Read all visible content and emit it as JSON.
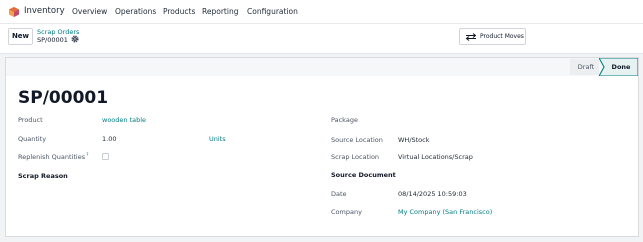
{
  "nav": {
    "app_name": "Inventory",
    "menu": [
      "Overview",
      "Operations",
      "Products",
      "Reporting",
      "Configuration"
    ]
  },
  "control_panel": {
    "new_label": "New",
    "breadcrumb": "Scrap Orders",
    "record": "SP/00001",
    "product_moves_label": "Product Moves"
  },
  "statusbar": {
    "stages": [
      "Draft",
      "Done"
    ],
    "current": "Done"
  },
  "form": {
    "title": "SP/00001",
    "left": {
      "product_label": "Product",
      "product_value": "wooden table",
      "quantity_label": "Quantity",
      "quantity_value": "1.00",
      "uom_value": "Units",
      "replenish_label": "Replenish Quantities",
      "replenish_help": "?",
      "replenish_checked": false,
      "scrap_reason_label": "Scrap Reason"
    },
    "right": {
      "package_label": "Package",
      "package_value": "",
      "source_location_label": "Source Location",
      "source_location_value": "WH/Stock",
      "scrap_location_label": "Scrap Location",
      "scrap_location_value": "Virtual Locations/Scrap",
      "source_document_label": "Source Document",
      "source_document_value": "",
      "date_label": "Date",
      "date_value": "08/14/2025 10:59:03",
      "company_label": "Company",
      "company_value": "My Company (San Francisco)"
    }
  },
  "colors": {
    "link": "#017e84",
    "brand": "#714b67"
  }
}
